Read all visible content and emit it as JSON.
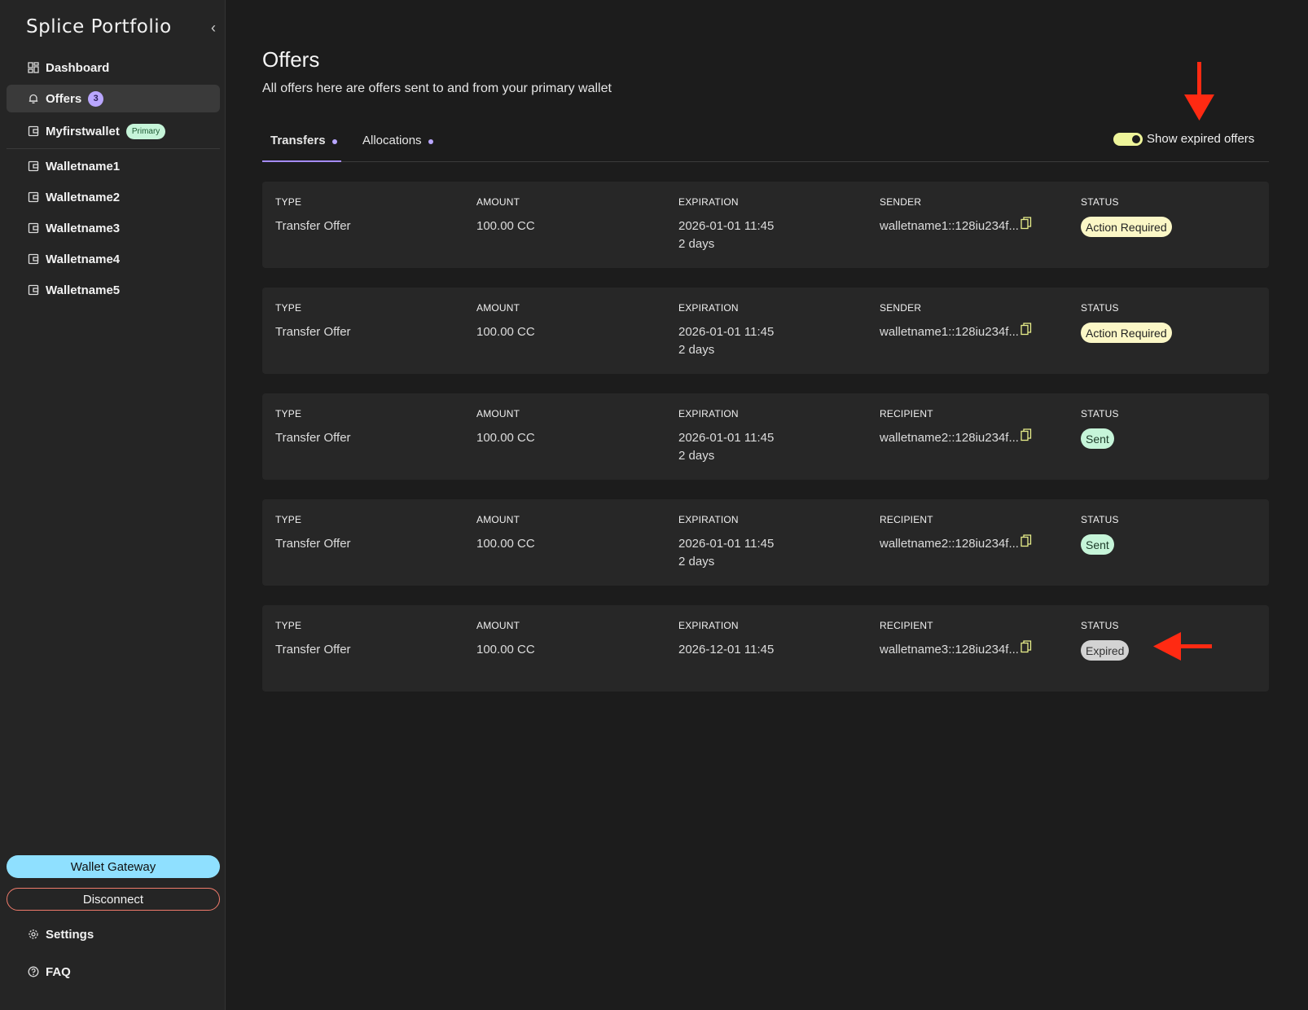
{
  "sidebar": {
    "brand": "Splice Portfolio",
    "collapse_icon": "chevron-left-icon",
    "items": [
      {
        "label": "Dashboard",
        "icon": "dashboard-icon"
      },
      {
        "label": "Offers",
        "icon": "bell-icon",
        "badge": "3"
      },
      {
        "label": "Myfirstwallet",
        "icon": "wallet-icon",
        "badge": "Primary"
      },
      {
        "label": "Walletname1",
        "icon": "wallet-icon"
      },
      {
        "label": "Walletname2",
        "icon": "wallet-icon"
      },
      {
        "label": "Walletname3",
        "icon": "wallet-icon"
      },
      {
        "label": "Walletname4",
        "icon": "wallet-icon"
      },
      {
        "label": "Walletname5",
        "icon": "wallet-icon"
      }
    ],
    "gateway_button": "Wallet Gateway",
    "disconnect_button": "Disconnect",
    "settings": "Settings",
    "faq": "FAQ"
  },
  "main": {
    "title": "Offers",
    "subtitle": "All offers here are offers sent to and from your primary wallet",
    "tabs": [
      {
        "label": "Transfers",
        "active": true
      },
      {
        "label": "Allocations",
        "active": false
      }
    ],
    "toggle_label": "Show expired offers",
    "toggle_on": true
  },
  "labels": {
    "type": "TYPE",
    "amount": "AMOUNT",
    "expiration": "EXPIRATION",
    "sender": "SENDER",
    "recipient": "RECIPIENT",
    "status": "STATUS"
  },
  "offers": [
    {
      "type": "Transfer Offer",
      "amount": "100.00 CC",
      "expiration": "2026-01-01 11:45",
      "relative": "2 days",
      "party_label": "SENDER",
      "party": "walletname1::128iu234f...",
      "status": "Action Required",
      "status_kind": "action"
    },
    {
      "type": "Transfer Offer",
      "amount": "100.00 CC",
      "expiration": "2026-01-01 11:45",
      "relative": "2 days",
      "party_label": "SENDER",
      "party": "walletname1::128iu234f...",
      "status": "Action Required",
      "status_kind": "action"
    },
    {
      "type": "Transfer Offer",
      "amount": "100.00 CC",
      "expiration": "2026-01-01 11:45",
      "relative": "2 days",
      "party_label": "RECIPIENT",
      "party": "walletname2::128iu234f...",
      "status": "Sent",
      "status_kind": "sent"
    },
    {
      "type": "Transfer Offer",
      "amount": "100.00 CC",
      "expiration": "2026-01-01 11:45",
      "relative": "2 days",
      "party_label": "RECIPIENT",
      "party": "walletname2::128iu234f...",
      "status": "Sent",
      "status_kind": "sent"
    },
    {
      "type": "Transfer Offer",
      "amount": "100.00 CC",
      "expiration": "2026-12-01 11:45",
      "relative": "",
      "party_label": "RECIPIENT",
      "party": "walletname3::128iu234f...",
      "status": "Expired",
      "status_kind": "expired"
    }
  ],
  "colors": {
    "accent": "#a58cff",
    "gateway": "#8fe0ff",
    "disconnect_border": "#f07b6b",
    "annotation_arrow": "#ff2a12"
  }
}
